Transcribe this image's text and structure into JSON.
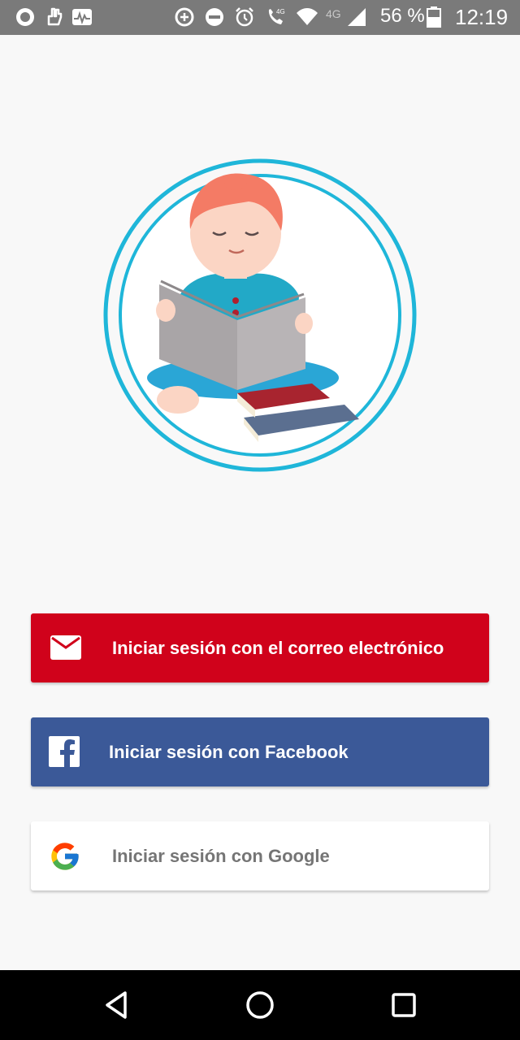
{
  "status_bar": {
    "left_icons": [
      "record-icon",
      "hand-icon",
      "activity-icon"
    ],
    "right_icons": [
      "data-saver-icon",
      "do-not-disturb-icon",
      "alarm-icon",
      "volte-call-icon",
      "wifi-icon",
      "signal-4g-icon"
    ],
    "network_label": "4G",
    "battery_percent": "56 %",
    "time": "12:19"
  },
  "hero": {
    "illustration": "boy-reading-book-illustration",
    "ring_color": "#1fb6d9"
  },
  "login": {
    "email": {
      "label": "Iniciar sesión con el correo electrónico",
      "icon": "mail-icon",
      "color": "#d0021b"
    },
    "facebook": {
      "label": "Iniciar sesión con Facebook",
      "icon": "facebook-icon",
      "color": "#3b5998"
    },
    "google": {
      "label": "Iniciar sesión con Google",
      "icon": "google-icon",
      "color": "#ffffff"
    }
  },
  "nav_bar": {
    "buttons": [
      "back-icon",
      "home-icon",
      "recents-icon"
    ]
  }
}
